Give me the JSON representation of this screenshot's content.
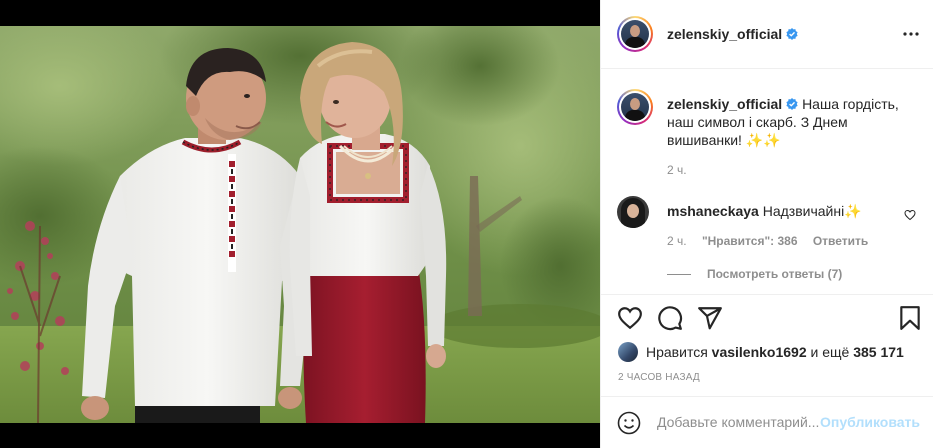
{
  "post": {
    "author": "zelenskiy_official",
    "verified": true,
    "caption": "Наша гордість, наш символ і скарб. З Днем вишиванки! ✨✨",
    "caption_time": "2 ч.",
    "posted_ago": "2 ЧАСОВ НАЗАД"
  },
  "header": {
    "more_icon": "more-horizontal-icon"
  },
  "comment": {
    "username": "mshaneckaya",
    "text": "Надзвичайні✨",
    "time": "2 ч.",
    "likes_label": "\"Нравится\": 386",
    "reply_label": "Ответить",
    "view_replies": "Посмотреть ответы (7)"
  },
  "likes": {
    "prefix": "Нравится",
    "user": "vasilenko1692",
    "middle": "и ещё",
    "count": "385 171"
  },
  "add_comment": {
    "placeholder": "Добавьте комментарий...",
    "publish": "Опубликовать"
  },
  "colors": {
    "accent": "#0095f6",
    "verified_badge": "#3897f0",
    "publish_disabled": "#b2dffc",
    "secondary_text": "#8e8e8e",
    "skirt": "#9c1c2c"
  }
}
